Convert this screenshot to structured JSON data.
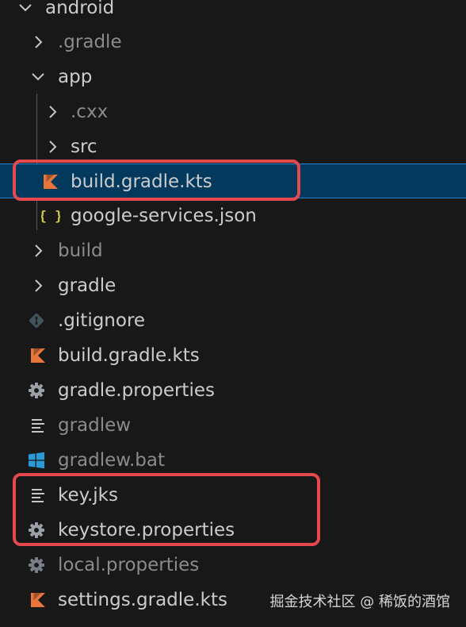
{
  "explorer": {
    "items": [
      {
        "label": "android",
        "kind": "folder-open",
        "muted": false
      },
      {
        "label": ".gradle",
        "kind": "folder",
        "muted": true
      },
      {
        "label": "app",
        "kind": "folder-open",
        "muted": false
      },
      {
        "label": ".cxx",
        "kind": "folder",
        "muted": true
      },
      {
        "label": "src",
        "kind": "folder",
        "muted": false
      },
      {
        "label": "build.gradle.kts",
        "kind": "kotlin-file",
        "muted": false,
        "selected": true
      },
      {
        "label": "google-services.json",
        "kind": "json-file",
        "muted": false
      },
      {
        "label": "build",
        "kind": "folder",
        "muted": true
      },
      {
        "label": "gradle",
        "kind": "folder",
        "muted": false
      },
      {
        "label": ".gitignore",
        "kind": "git-file",
        "muted": false
      },
      {
        "label": "build.gradle.kts",
        "kind": "kotlin-file",
        "muted": false
      },
      {
        "label": "gradle.properties",
        "kind": "settings-file",
        "muted": false
      },
      {
        "label": "gradlew",
        "kind": "text-file",
        "muted": true
      },
      {
        "label": "gradlew.bat",
        "kind": "windows-file",
        "muted": true
      },
      {
        "label": "key.jks",
        "kind": "text-file",
        "muted": false
      },
      {
        "label": "keystore.properties",
        "kind": "settings-file",
        "muted": false
      },
      {
        "label": "local.properties",
        "kind": "settings-file",
        "muted": true
      },
      {
        "label": "settings.gradle.kts",
        "kind": "kotlin-file",
        "muted": false
      }
    ]
  },
  "watermark": {
    "text": "掘金技术社区 @ 稀饭的酒馆"
  },
  "colors": {
    "background": "#181818",
    "selection": "#04395e",
    "selection_border": "#2a85d4",
    "highlight_box": "#e5484d",
    "kotlin_icon": "#e8763a",
    "json_icon": "#cbcb41",
    "text": "#cccccc",
    "text_muted": "#8b8b8b"
  }
}
